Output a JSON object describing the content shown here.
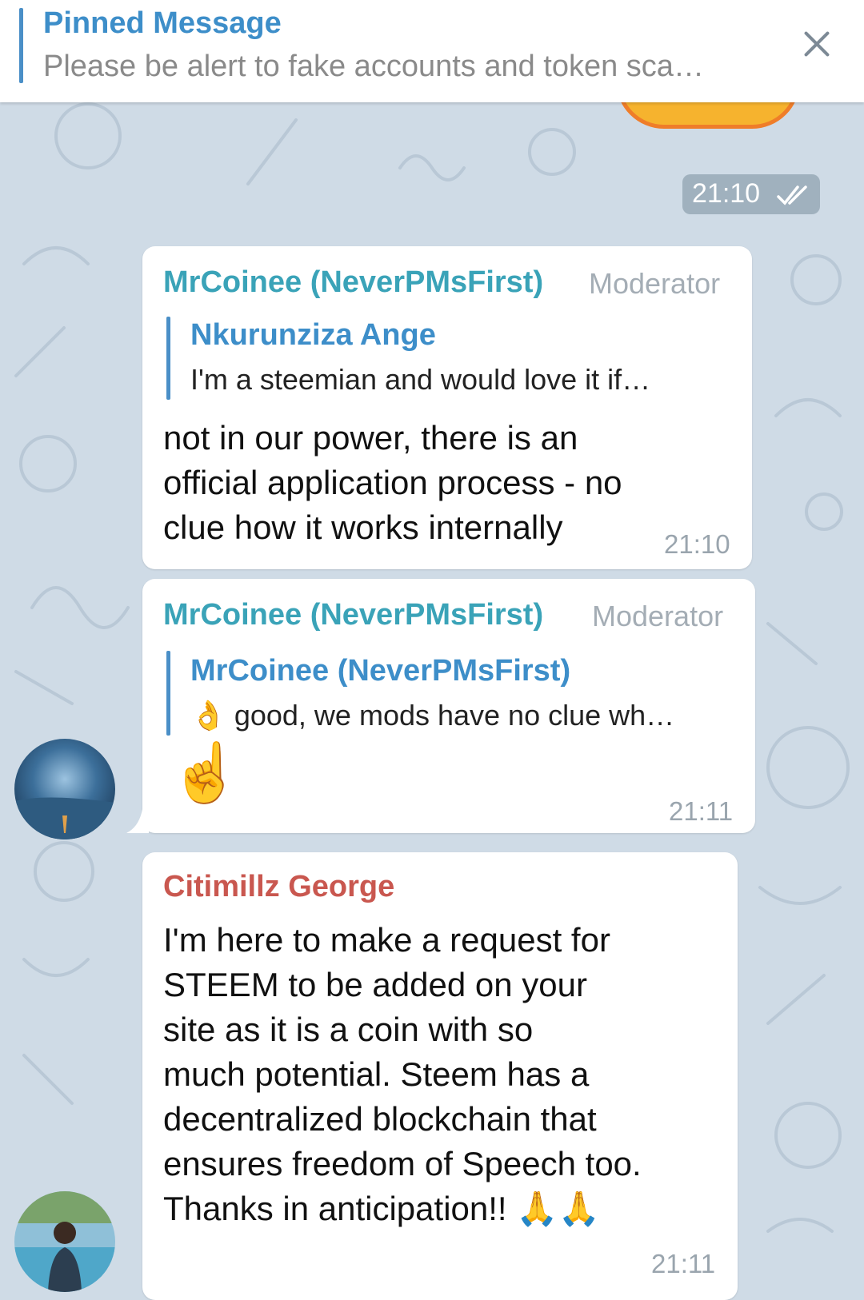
{
  "pinned": {
    "title": "Pinned Message",
    "text": "Please be alert to fake accounts and token sca…"
  },
  "own_message": {
    "time": "21:10"
  },
  "messages": [
    {
      "sender": "MrCoinee (NeverPMsFirst)",
      "role": "Moderator",
      "reply_to": {
        "name": "Nkurunziza Ange",
        "text": "I'm a steemian and would love it if…"
      },
      "lines": [
        "not in our power, there is an",
        "official application process - no",
        "clue how it works internally"
      ],
      "time": "21:10"
    },
    {
      "sender": "MrCoinee (NeverPMsFirst)",
      "role": "Moderator",
      "reply_to": {
        "name": "MrCoinee (NeverPMsFirst)",
        "emoji": "👌",
        "text": "good, we mods have no clue wh…"
      },
      "emoji": "☝️",
      "time": "21:11"
    },
    {
      "sender": "Citimillz George",
      "lines": [
        "I'm here to make a request for",
        "STEEM to be added on your",
        "site as it is a coin with so",
        "much potential. Steem has a",
        "decentralized blockchain that",
        "ensures freedom of Speech too.",
        "Thanks in anticipation!! 🙏🙏"
      ],
      "time": "21:11"
    }
  ],
  "colors": {
    "background": "#cfdbe6",
    "moderator_name": "#3aa3b8",
    "citimillz_name": "#c9574f",
    "reply_accent": "#4a8fc7"
  },
  "icons": [
    "close-icon",
    "double-check-icon",
    "avatar-storm",
    "avatar-pool"
  ]
}
